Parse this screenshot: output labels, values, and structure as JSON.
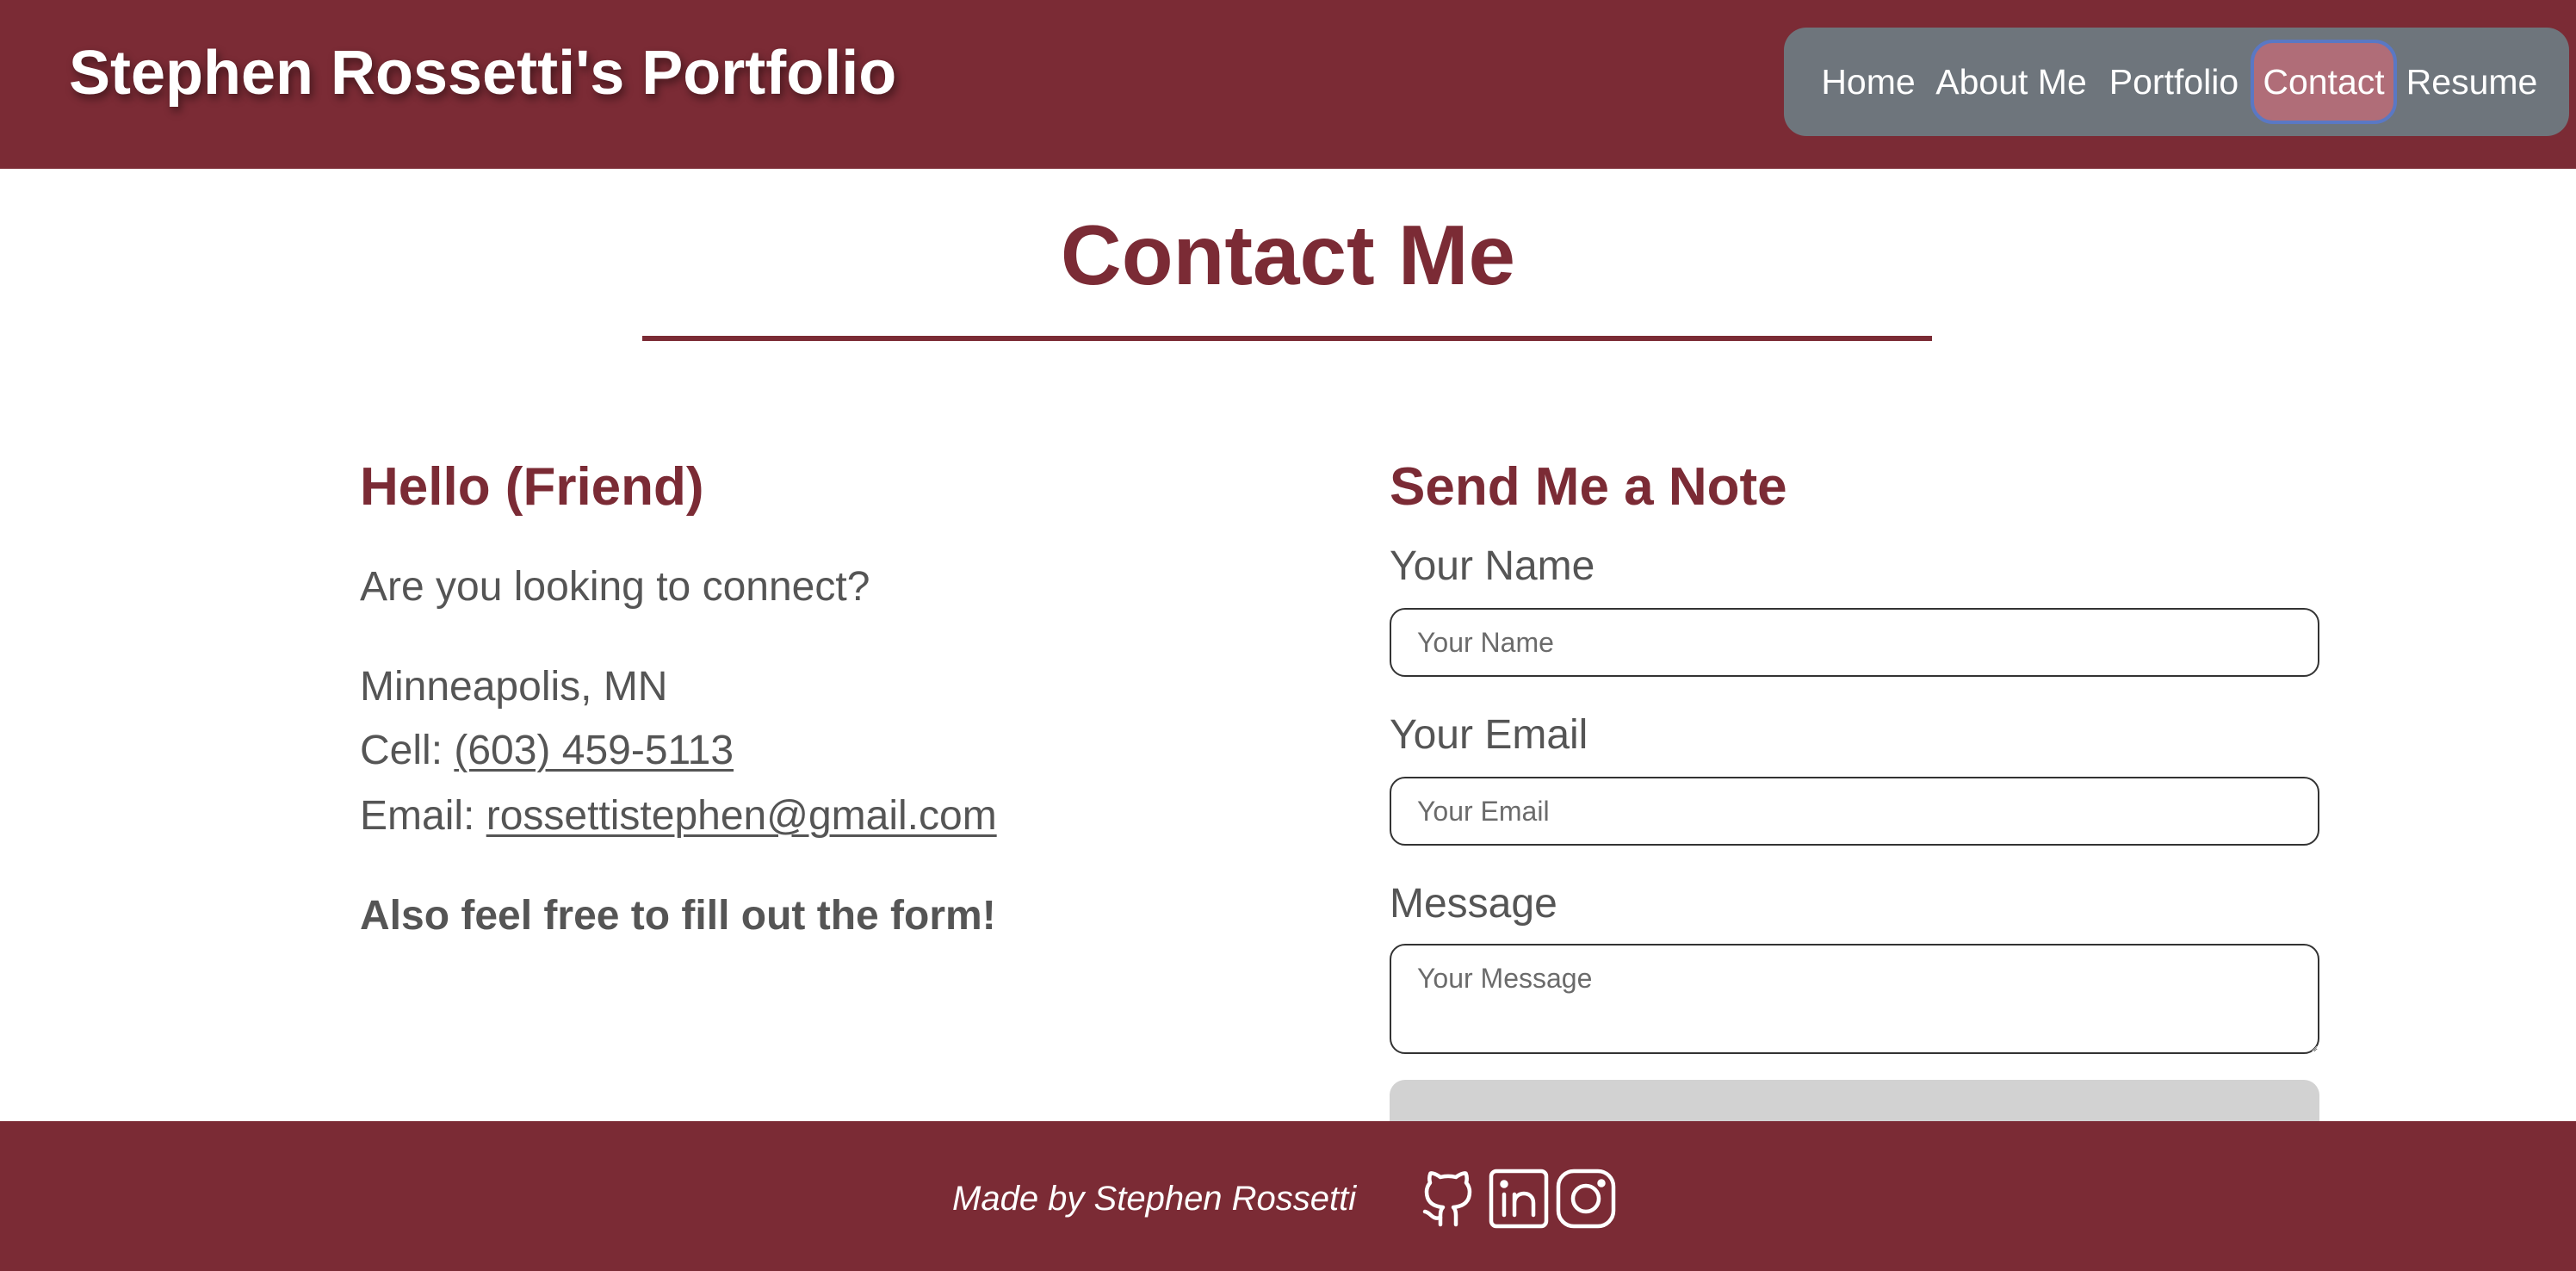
{
  "header": {
    "brand": "Stephen Rossetti's Portfolio",
    "nav": [
      "Home",
      "About Me",
      "Portfolio",
      "Contact",
      "Resume"
    ],
    "active_nav": "Contact"
  },
  "main": {
    "title": "Contact Me",
    "left": {
      "heading": "Hello (Friend)",
      "intro": "Are you looking to connect?",
      "location": "Minneapolis, MN",
      "cell_label": "Cell: ",
      "cell_value": "(603) 459-5113",
      "email_label": "Email: ",
      "email_value": "rossettistephen@gmail.com",
      "cta": "Also feel free to fill out the form!"
    },
    "form": {
      "heading": "Send Me a Note",
      "name_label": "Your Name",
      "name_placeholder": "Your Name",
      "email_label": "Your Email",
      "email_placeholder": "Your Email",
      "message_label": "Message",
      "message_placeholder": "Your Message"
    }
  },
  "footer": {
    "credit": "Made by Stephen Rossetti",
    "social_icons": [
      "github-icon",
      "linkedin-icon",
      "instagram-icon"
    ]
  },
  "colors": {
    "brand": "#7b2b35",
    "nav_bg": "#6e757c",
    "nav_active": "#b06d78",
    "text": "#555555"
  }
}
